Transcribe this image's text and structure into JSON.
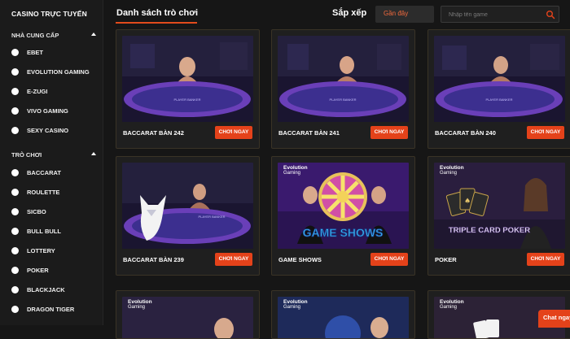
{
  "sidebar": {
    "title": "CASINO TRỰC TUYẾN",
    "providers_heading": "NHÀ CUNG CẤP",
    "providers": [
      "EBET",
      "EVOLUTION GAMING",
      "E-ZUGI",
      "VIVO GAMING",
      "SEXY CASINO"
    ],
    "games_heading": "TRÒ CHƠI",
    "games": [
      "BACCARAT",
      "ROULETTE",
      "SICBO",
      "BULL BULL",
      "LOTTERY",
      "POKER",
      "BLACKJACK",
      "DRAGON TIGER"
    ]
  },
  "header": {
    "title": "Danh sách trò chơi",
    "sort_label": "Sắp xếp",
    "sort_value": "Gần đây",
    "search_placeholder": "Nhập tên game"
  },
  "cards": [
    {
      "name": "BACCARAT BÀN 242",
      "button": "CHƠI NGAY",
      "thumb_text": "PLAYER BANKER"
    },
    {
      "name": "BACCARAT BÀN 241",
      "button": "CHƠI NGAY",
      "thumb_text": "PLAYER BANKER"
    },
    {
      "name": "BACCARAT BÀN 240",
      "button": "CHƠI NGAY",
      "thumb_text": "PLAYER BANKER"
    },
    {
      "name": "BACCARAT BÀN 239",
      "button": "CHƠI NGAY",
      "thumb_text": "PLAYER BANKER"
    },
    {
      "name": "GAME SHOWS",
      "button": "CHƠI NGAY",
      "thumb_text": "GAME SHOWS"
    },
    {
      "name": "POKER",
      "button": "CHƠI NGAY",
      "thumb_text": "TRIPLE CARD POKER"
    }
  ],
  "evo_logo": {
    "line1": "Evolution",
    "line2": "Gaming"
  },
  "chat_label": "Chat ngay",
  "colors": {
    "accent": "#e4421a",
    "background": "#161616",
    "sidebar": "#1b1b1b",
    "card_border": "#3a3326"
  }
}
